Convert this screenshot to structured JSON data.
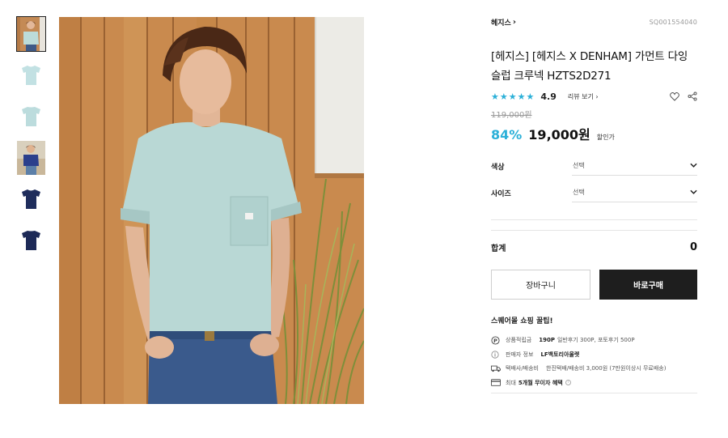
{
  "thumbnails": [
    {
      "name": "model-mint-front"
    },
    {
      "name": "mint-tee-front"
    },
    {
      "name": "mint-tee-back"
    },
    {
      "name": "model-navy-front"
    },
    {
      "name": "navy-tee-front"
    },
    {
      "name": "navy-tee-back"
    }
  ],
  "product": {
    "brand": "헤지스",
    "sku": "SQ001554040",
    "title": "[헤지스] [헤지스 X DENHAM] 가먼트 다잉 슬럽 크루넥 HZTS2D271",
    "rating": "4.9",
    "review_link": "리뷰 보기",
    "original_price": "119,000원",
    "discount": "84%",
    "price": "19,000원",
    "price_note": "할인가"
  },
  "options": [
    {
      "label": "색상",
      "value": "선택"
    },
    {
      "label": "사이즈",
      "value": "선택"
    }
  ],
  "total": {
    "label": "합계",
    "value": "0"
  },
  "buttons": {
    "cart": "장바구니",
    "buy": "바로구매"
  },
  "tips": {
    "title": "스퀘어몰 쇼핑 꿀팁!",
    "points": {
      "label": "상품적립금",
      "value": "190P",
      "rest": "일반후기 300P, 포토후기 500P"
    },
    "seller": {
      "label": "판매자 정보",
      "value": "LF백토리아울렛"
    },
    "shipping": {
      "label": "택배사/배송비",
      "rest": "한진택배/배송비 3,000원 (7만원이상시 무료배송)"
    },
    "installment": {
      "prefix": "최대",
      "value": "5개월 무이자 혜택"
    }
  },
  "colors": {
    "accent": "#2bb0d8",
    "buy_button": "#1e1e1e"
  },
  "icons": {
    "wishlist": "heart-icon",
    "share": "share-icon",
    "points": "points-p-icon",
    "seller": "info-icon",
    "shipping": "truck-icon",
    "card": "card-icon"
  }
}
